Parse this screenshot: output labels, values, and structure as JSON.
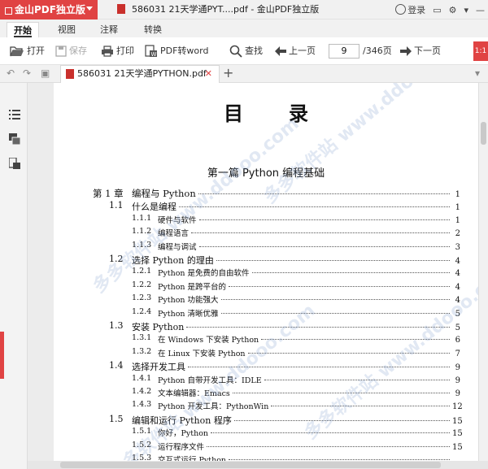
{
  "titlebar": {
    "app_name": "金山PDF独立版",
    "doc_title": "586031 21天学通PYT....pdf - 金山PDF独立版",
    "login": "登录"
  },
  "menu": {
    "tabs": [
      "开始",
      "视图",
      "注释",
      "转换"
    ]
  },
  "toolbar": {
    "open": "打开",
    "save": "保存",
    "print": "打印",
    "pdf_to_word": "PDF转word",
    "find": "查找",
    "prev_page": "上一页",
    "current_page": "9",
    "total_pages": "/346页",
    "next_page": "下一页",
    "red_tool": "1:1"
  },
  "doc_tab": {
    "name": "586031 21天学通PYTHON.pdf"
  },
  "document": {
    "toc_title": "目录",
    "part_title": "第一篇   Python 编程基础",
    "toc": [
      {
        "num": "第 1 章",
        "text": "编程与 Python",
        "page": "1",
        "level": 1
      },
      {
        "num": "1.1",
        "text": "什么是编程",
        "page": "1",
        "level": 2
      },
      {
        "num": "1.1.1",
        "text": "硬件与软件",
        "page": "1",
        "level": 3
      },
      {
        "num": "1.1.2",
        "text": "编程语言",
        "page": "2",
        "level": 3
      },
      {
        "num": "1.1.3",
        "text": "编程与调试",
        "page": "3",
        "level": 3
      },
      {
        "num": "1.2",
        "text": "选择 Python 的理由",
        "page": "4",
        "level": 2
      },
      {
        "num": "1.2.1",
        "text": "Python 是免费的自由软件",
        "page": "4",
        "level": 3
      },
      {
        "num": "1.2.2",
        "text": "Python 是跨平台的",
        "page": "4",
        "level": 3
      },
      {
        "num": "1.2.3",
        "text": "Python 功能强大",
        "page": "4",
        "level": 3
      },
      {
        "num": "1.2.4",
        "text": "Python 清晰优雅",
        "page": "5",
        "level": 3
      },
      {
        "num": "1.3",
        "text": "安装 Python",
        "page": "5",
        "level": 2
      },
      {
        "num": "1.3.1",
        "text": "在 Windows 下安装 Python",
        "page": "6",
        "level": 3
      },
      {
        "num": "1.3.2",
        "text": "在 Linux 下安装 Python",
        "page": "7",
        "level": 3
      },
      {
        "num": "1.4",
        "text": "选择开发工具",
        "page": "9",
        "level": 2
      },
      {
        "num": "1.4.1",
        "text": "Python 自带开发工具：IDLE",
        "page": "9",
        "level": 3
      },
      {
        "num": "1.4.2",
        "text": "文本编辑器：Emacs",
        "page": "9",
        "level": 3
      },
      {
        "num": "1.4.3",
        "text": "Python 开发工具：PythonWin",
        "page": "12",
        "level": 3
      },
      {
        "num": "1.5",
        "text": "编辑和运行 Python 程序",
        "page": "15",
        "level": 2
      },
      {
        "num": "1.5.1",
        "text": "你好，Python",
        "page": "15",
        "level": 3
      },
      {
        "num": "1.5.2",
        "text": "运行程序文件",
        "page": "15",
        "level": 3
      },
      {
        "num": "1.5.3",
        "text": "交互式运行 Python",
        "page": "",
        "level": 3
      }
    ]
  },
  "watermark": {
    "text": "多多软件站 www.ddooo.com"
  },
  "colors": {
    "accent": "#e04343",
    "pdf_icon": "#c9302c"
  }
}
